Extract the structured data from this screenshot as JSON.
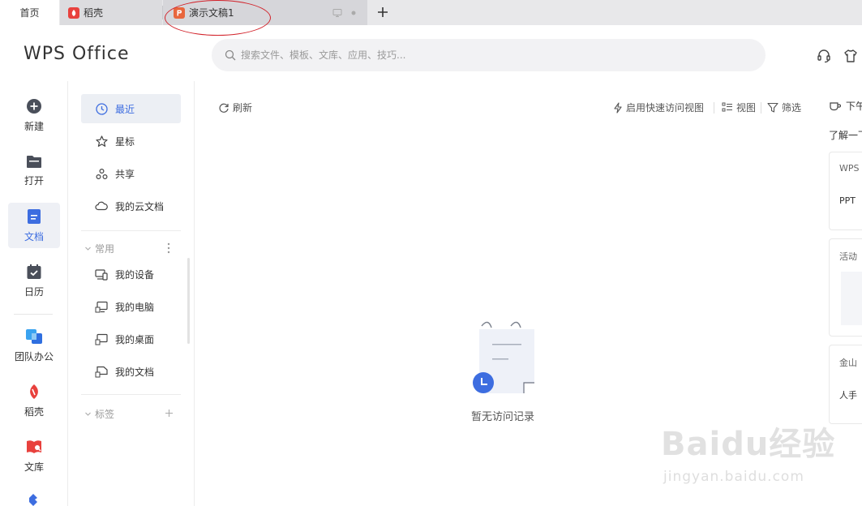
{
  "tabs": [
    {
      "label": "首页"
    },
    {
      "label": "稻壳"
    },
    {
      "label": "演示文稿1"
    }
  ],
  "header": {
    "logo": "WPS Office",
    "search_placeholder": "搜索文件、模板、文库、应用、技巧..."
  },
  "nav": {
    "items": [
      {
        "label": "新建"
      },
      {
        "label": "打开"
      },
      {
        "label": "文档"
      },
      {
        "label": "日历"
      },
      {
        "label": "团队办公"
      },
      {
        "label": "稻壳"
      },
      {
        "label": "文库"
      }
    ]
  },
  "side": {
    "recent": "最近",
    "starred": "星标",
    "shared": "共享",
    "cloud": "我的云文档",
    "common_header": "常用",
    "device": "我的设备",
    "computer": "我的电脑",
    "desktop": "我的桌面",
    "documents": "我的文档",
    "tags_header": "标签"
  },
  "toolbar": {
    "refresh": "刷新",
    "quick_access": "启用快速访问视图",
    "view": "视图",
    "filter": "筛选"
  },
  "empty": {
    "message": "暂无访问记录"
  },
  "right_panel": {
    "title": "下午",
    "subtitle": "了解一下",
    "cards": [
      {
        "title": "WPS",
        "body": "PPT"
      },
      {
        "title": "活动",
        "body": ""
      },
      {
        "title": "金山",
        "body": "人手"
      }
    ]
  },
  "watermark": {
    "logo": "Baidu经验",
    "url": "jingyan.baidu.com"
  },
  "colors": {
    "accent": "#3d6de0",
    "brand_red": "#e8413d",
    "ppt_orange": "#e8663d",
    "annotation_red": "#d2222a"
  }
}
